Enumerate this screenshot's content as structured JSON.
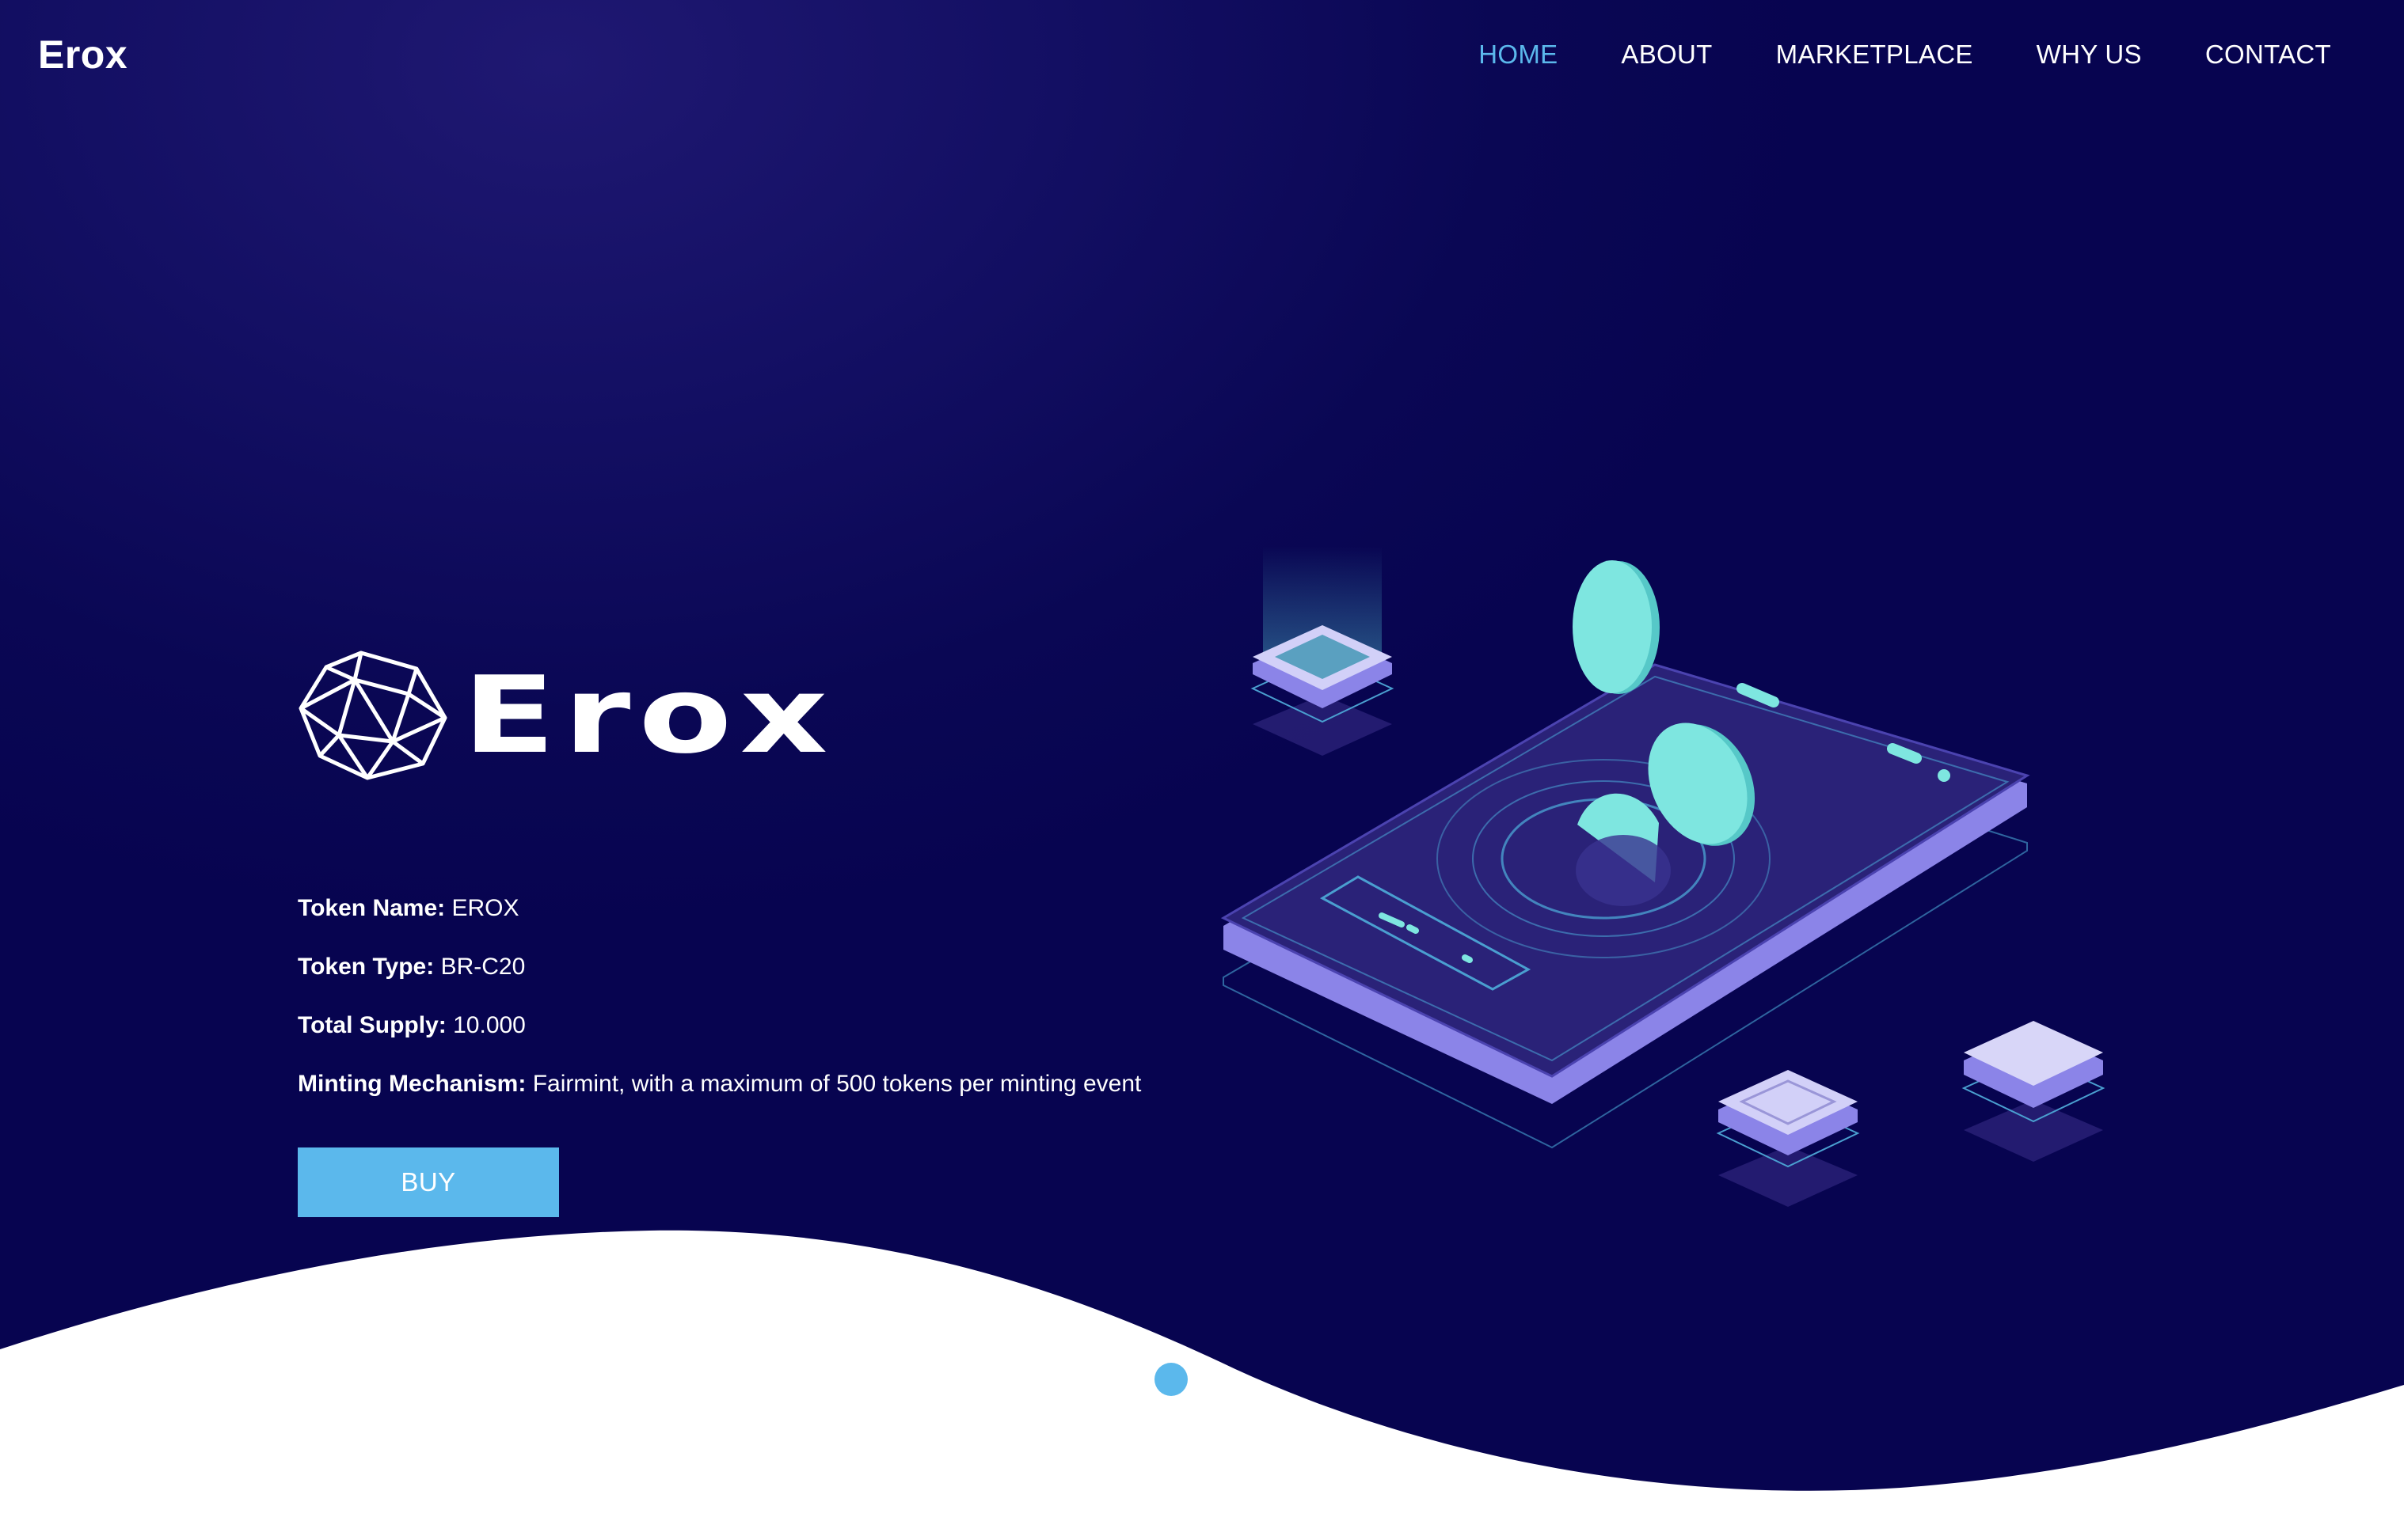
{
  "header": {
    "logo": "Erox",
    "nav": [
      {
        "label": "HOME",
        "active": true
      },
      {
        "label": "ABOUT",
        "active": false
      },
      {
        "label": "MARKETPLACE",
        "active": false
      },
      {
        "label": "WHY US",
        "active": false
      },
      {
        "label": "CONTACT",
        "active": false
      }
    ]
  },
  "hero": {
    "brand_word": "Erox",
    "info": [
      {
        "label": "Token Name:",
        "value": "EROX"
      },
      {
        "label": "Token Type:",
        "value": "BR-C20"
      },
      {
        "label": "Total Supply:",
        "value": "10.000"
      },
      {
        "label": "Minting Mechanism:",
        "value": "Fairmint, with a maximum of 500 tokens per minting event"
      }
    ],
    "buy_label": "BUY"
  },
  "carousel": {
    "slides": 2,
    "active_index": 0
  },
  "colors": {
    "background": "#0a0754",
    "accent": "#5bb8ec",
    "coin": "#7ee6e0",
    "phone": "#2a2278",
    "phone_edge": "#8b84e8"
  },
  "icons": [
    "icosahedron-logo-icon",
    "phone-illustration",
    "coin-icon",
    "chip-block-icon"
  ]
}
